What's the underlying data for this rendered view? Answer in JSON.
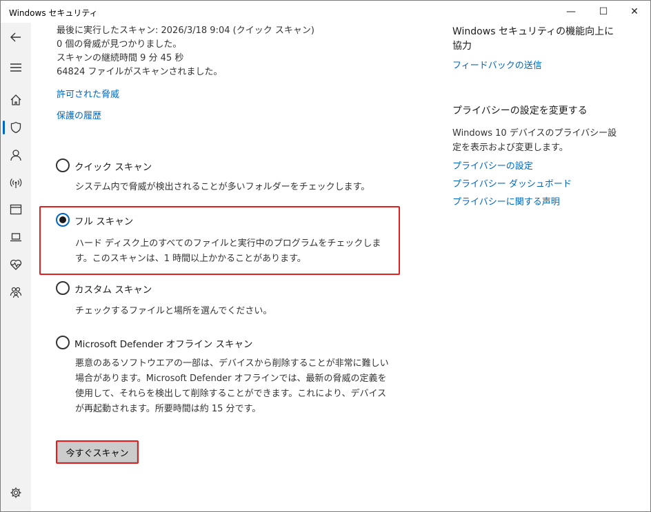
{
  "window": {
    "title": "Windows セキュリティ",
    "minimize": "—",
    "maximize": "☐",
    "close": "✕"
  },
  "scan_info": {
    "last_scan": "最後に実行したスキャン: 2026/3/18 9:04 (クイック スキャン)",
    "threats_found": "0 個の脅威が見つかりました。",
    "duration": "スキャンの継続時間 9 分 45 秒",
    "files_scanned": "64824 ファイルがスキャンされました。"
  },
  "links": {
    "allowed_threats": "許可された脅威",
    "protection_history": "保護の履歴"
  },
  "options": [
    {
      "label": "クイック スキャン",
      "desc": "システム内で脅威が検出されることが多いフォルダーをチェックします。",
      "checked": false
    },
    {
      "label": "フル スキャン",
      "desc": "ハード ディスク上のすべてのファイルと実行中のプログラムをチェックします。このスキャンは、1 時間以上かかることがあります。",
      "checked": true
    },
    {
      "label": "カスタム スキャン",
      "desc": "チェックするファイルと場所を選んでください。",
      "checked": false
    },
    {
      "label": "Microsoft Defender オフライン スキャン",
      "desc": "悪意のあるソフトウエアの一部は、デバイスから削除することが非常に難しい場合があります。Microsoft Defender オフラインでは、最新の脅威の定義を使用して、それらを検出して削除することができます。これにより、デバイスが再起動されます。所要時間は約 15 分です。",
      "checked": false
    }
  ],
  "scan_button": "今すぐスキャン",
  "right_panel": {
    "improve_heading": "Windows セキュリティの機能向上に協力",
    "feedback_link": "フィードバックの送信",
    "privacy_heading": "プライバシーの設定を変更する",
    "privacy_text": "Windows 10 デバイスのプライバシー設定を表示および変更します。",
    "privacy_settings_link": "プライバシーの設定",
    "privacy_dashboard_link": "プライバシー ダッシュボード",
    "privacy_statement_link": "プライバシーに関する声明"
  },
  "sidebar_icons": [
    "back-icon",
    "menu-icon",
    "home-icon",
    "shield-icon",
    "account-icon",
    "wireless-icon",
    "app-browser-icon",
    "device-icon",
    "health-icon",
    "family-icon",
    "settings-icon"
  ],
  "colors": {
    "accent": "#0067c0",
    "highlight": "#e02020",
    "sidebar": "#f2f2f2",
    "button": "#cccccc"
  }
}
